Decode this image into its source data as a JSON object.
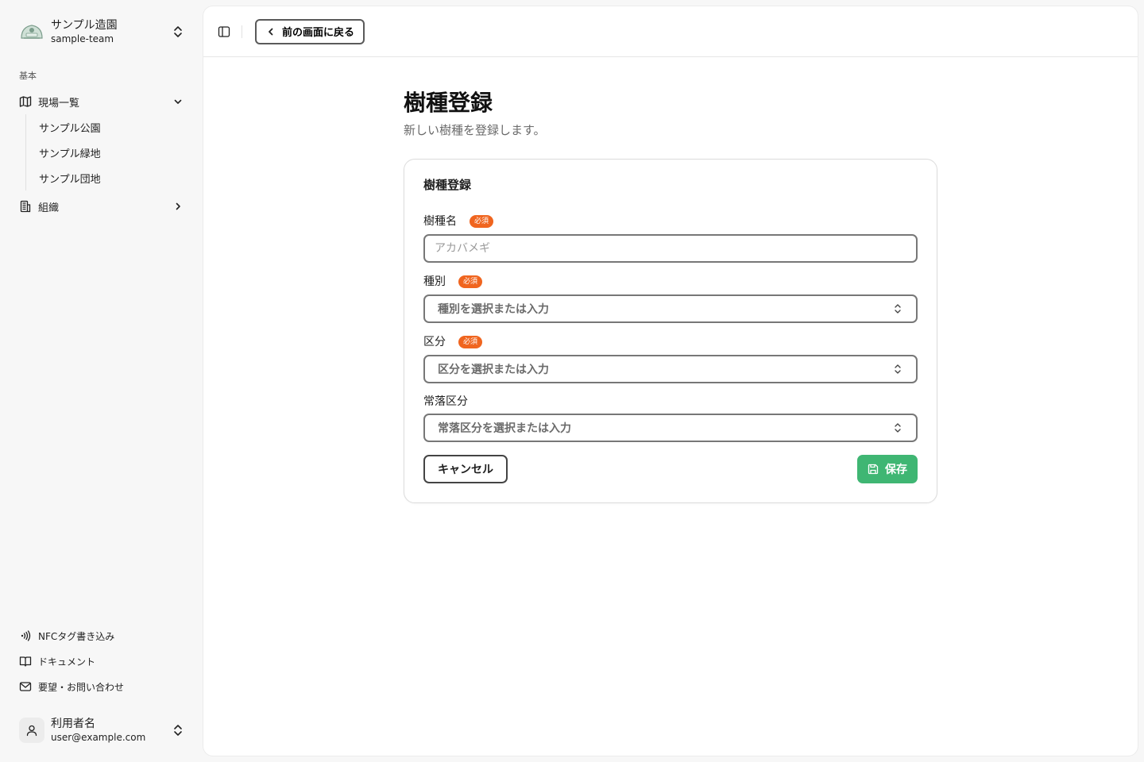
{
  "team": {
    "name": "サンプル造園",
    "slug": "sample-team",
    "logo_icon": "garden-logo-icon"
  },
  "sidebar": {
    "group_label": "基本",
    "items": [
      {
        "label": "現場一覧",
        "icon": "map-icon",
        "expanded": true,
        "children": [
          "サンプル公園",
          "サンプル緑地",
          "サンプル団地"
        ]
      },
      {
        "label": "組織",
        "icon": "building-icon",
        "expanded": false
      }
    ],
    "footer_items": [
      {
        "label": "NFCタグ書き込み",
        "icon": "nfc-icon"
      },
      {
        "label": "ドキュメント",
        "icon": "book-icon"
      },
      {
        "label": "要望・お問い合わせ",
        "icon": "mail-icon"
      }
    ]
  },
  "user": {
    "name": "利用者名",
    "email": "user@example.com"
  },
  "topbar": {
    "back_label": "前の画面に戻る"
  },
  "page": {
    "title": "樹種登録",
    "subtitle": "新しい樹種を登録します。"
  },
  "form": {
    "card_title": "樹種登録",
    "required_label": "必須",
    "fields": {
      "species_name": {
        "label": "樹種名",
        "placeholder": "アカバメギ",
        "value": ""
      },
      "type": {
        "label": "種別",
        "placeholder": "種別を選択または入力"
      },
      "category": {
        "label": "区分",
        "placeholder": "区分を選択または入力"
      },
      "evergreen": {
        "label": "常落区分",
        "placeholder": "常落区分を選択または入力"
      }
    },
    "cancel_label": "キャンセル",
    "save_label": "保存"
  },
  "colors": {
    "accent_green": "#3fb673",
    "required_orange": "#f0651f"
  }
}
